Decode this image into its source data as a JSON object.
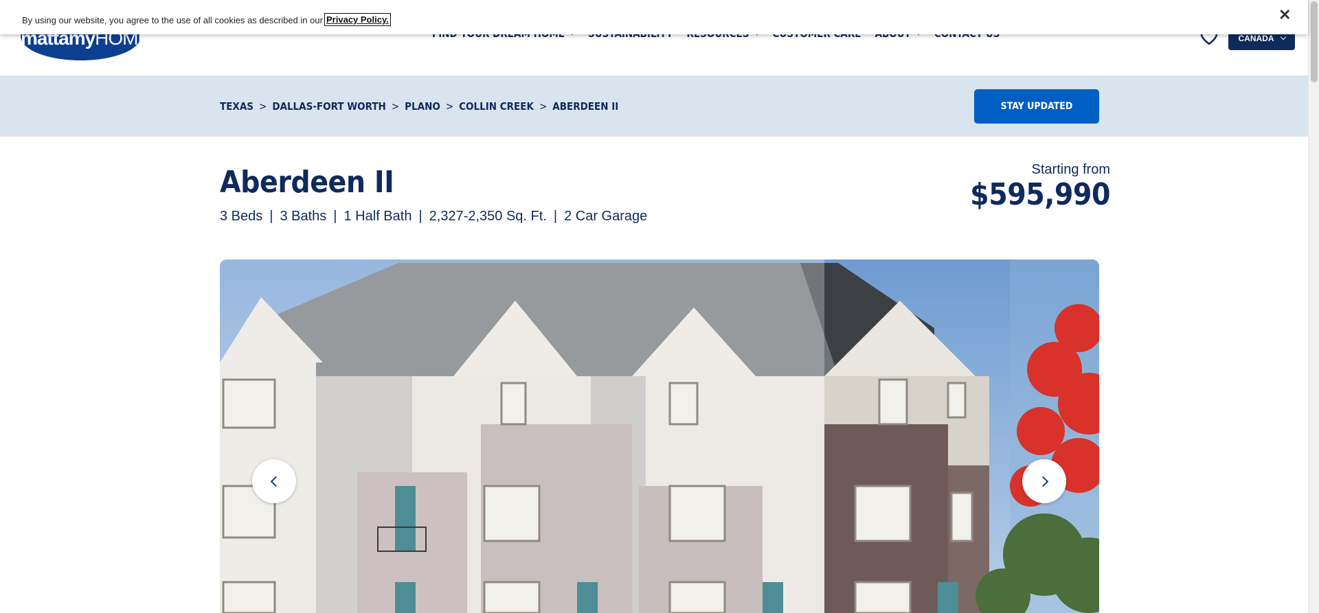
{
  "cookie": {
    "text": "By using our website, you agree to the use of all cookies as described in our",
    "link": "Privacy Policy.",
    "close": "✕"
  },
  "header": {
    "logo_bold": "mattamy",
    "logo_thin": "HOMES",
    "nav": [
      {
        "label": "FIND YOUR DREAM HOME",
        "dropdown": true
      },
      {
        "label": "SUSTAINABILITY",
        "dropdown": false
      },
      {
        "label": "RESOURCES",
        "dropdown": true
      },
      {
        "label": "CUSTOMER CARE",
        "dropdown": false
      },
      {
        "label": "ABOUT",
        "dropdown": true
      },
      {
        "label": "CONTACT US",
        "dropdown": false
      }
    ],
    "favorites_icon": "heart-icon",
    "country": "CANADA"
  },
  "breadcrumb": {
    "items": [
      "TEXAS",
      "DALLAS-FORT WORTH",
      "PLANO",
      "COLLIN CREEK",
      "ABERDEEN II"
    ],
    "separator": ">"
  },
  "stay_updated": "STAY UPDATED",
  "home": {
    "title": "Aberdeen II",
    "specs": [
      "3 Beds",
      "3 Baths",
      "1 Half Bath",
      "2,327-2,350 Sq. Ft.",
      "2 Car Garage"
    ],
    "spec_separator": "|",
    "price_label": "Starting from",
    "price": "$595,990"
  },
  "carousel": {
    "prev_icon": "chevron-left-icon",
    "next_icon": "chevron-right-icon"
  },
  "colors": {
    "navy": "#0f2a5c",
    "button_blue": "#005ec4",
    "crumb_bg": "#d9e4ee"
  }
}
